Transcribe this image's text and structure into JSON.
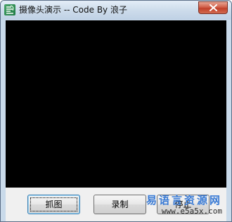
{
  "window": {
    "title": "摄像头演示 -- Code By 浪子",
    "close_icon": "close-x-icon",
    "app_icon": "app-logo-icon"
  },
  "buttons": {
    "capture_label": "抓图",
    "record_label": "录制",
    "stop_label": "停止"
  },
  "watermark": {
    "line1": "易语言资源网",
    "line2": "www.e5a5x.com"
  },
  "colors": {
    "video_background": "#000000",
    "watermark_accent": "#3a7bd5",
    "close_button": "#c1402a"
  }
}
